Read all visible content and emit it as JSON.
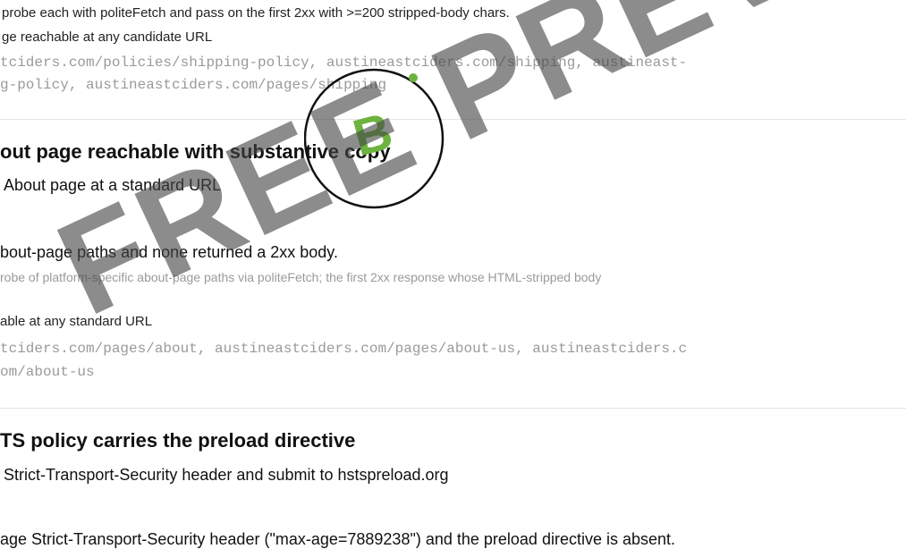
{
  "sections": {
    "shipping": {
      "intro": "probe each with politeFetch and pass on the first 2xx with >=200 stripped-body chars.",
      "fail_label": "ge reachable at any candidate URL",
      "urls_line1": "tciders.com/policies/shipping-policy, austineastciders.com/shipping, austineast-",
      "urls_line2": "g-policy, austineastciders.com/pages/shipping"
    },
    "about": {
      "title": "out page reachable with substantive copy",
      "subtitle": "About page at a standard URL",
      "result": "bout-page paths and none returned a 2xx body.",
      "detail": "robe of platform-specific about-page paths via politeFetch; the first 2xx response whose HTML-stripped body",
      "fail_label": "able at any standard URL",
      "urls_line1": "tciders.com/pages/about, austineastciders.com/pages/about-us, austineastciders.c",
      "urls_line2": "om/about-us"
    },
    "hsts": {
      "title": "TS policy carries the preload directive",
      "subtitle": "Strict-Transport-Security header and submit to hstspreload.org",
      "result": "age Strict-Transport-Security header (\"max-age=7889238\") and the preload directive is absent."
    }
  },
  "badge": {
    "letter": "B",
    "letter_color": "#6db33f",
    "ring_color": "#111111",
    "dot_color": "#6db33f"
  },
  "watermark": {
    "text": "FREE PREVIEW"
  }
}
